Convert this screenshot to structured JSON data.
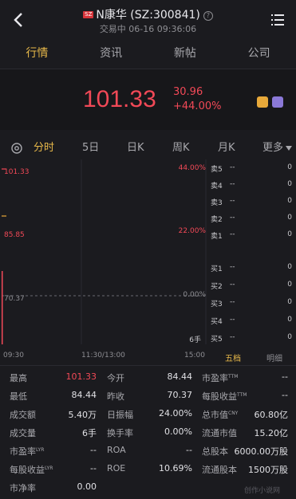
{
  "header": {
    "badge": "SZ",
    "title": "N康华 (SZ:300841)",
    "help": "?",
    "subtitle": "交易中 06-16 09:36:06"
  },
  "tabs": [
    "行情",
    "资讯",
    "新帖",
    "公司"
  ],
  "quote": {
    "price": "101.33",
    "change": "30.96",
    "change_pct": "+44.00%"
  },
  "chart_tabs": [
    "分时",
    "5日",
    "日K",
    "周K",
    "月K",
    "更多"
  ],
  "chart": {
    "y_left": [
      "101.33",
      "85.85",
      "70.37"
    ],
    "y_right": [
      "44.00%",
      "22.00%",
      "0.00%"
    ],
    "vol_label": "6手",
    "times": [
      "09:30",
      "11:30/13:00",
      "15:00"
    ]
  },
  "order_book": {
    "sell": [
      {
        "label": "卖5",
        "price": "--",
        "vol": "0"
      },
      {
        "label": "卖4",
        "price": "--",
        "vol": "0"
      },
      {
        "label": "卖3",
        "price": "--",
        "vol": "0"
      },
      {
        "label": "卖2",
        "price": "--",
        "vol": "0"
      },
      {
        "label": "卖1",
        "price": "--",
        "vol": "0"
      }
    ],
    "buy": [
      {
        "label": "买1",
        "price": "--",
        "vol": "0"
      },
      {
        "label": "买2",
        "price": "--",
        "vol": "0"
      },
      {
        "label": "买3",
        "price": "--",
        "vol": "0"
      },
      {
        "label": "买4",
        "price": "--",
        "vol": "0"
      },
      {
        "label": "买5",
        "price": "--",
        "vol": "0"
      }
    ],
    "tab_five": "五档",
    "tab_detail": "明细"
  },
  "stats": {
    "rows": [
      [
        {
          "label": "最高",
          "value": "101.33",
          "red": true
        },
        {
          "label": "今开",
          "value": "84.44",
          "red": false
        },
        {
          "label": "市盈率",
          "sup": "TTM",
          "value": "--",
          "red": false
        }
      ],
      [
        {
          "label": "最低",
          "value": "84.44",
          "red": false
        },
        {
          "label": "昨收",
          "value": "70.37",
          "red": false
        },
        {
          "label": "每股收益",
          "sup": "TTM",
          "value": "--",
          "red": false
        }
      ],
      [
        {
          "label": "成交额",
          "value": "5.40万",
          "red": false
        },
        {
          "label": "日振幅",
          "value": "24.00%",
          "red": false
        },
        {
          "label": "总市值",
          "sup": "CNY",
          "value": "60.80亿",
          "red": false
        }
      ],
      [
        {
          "label": "成交量",
          "value": "6手",
          "red": false
        },
        {
          "label": "换手率",
          "value": "0.00%",
          "red": false
        },
        {
          "label": "流通市值",
          "value": "15.20亿",
          "red": false
        }
      ],
      [
        {
          "label": "市盈率",
          "sup": "LYR",
          "value": "--",
          "red": false
        },
        {
          "label": "ROA",
          "value": "--",
          "red": false
        },
        {
          "label": "总股本",
          "value": "6000.00万股",
          "red": false
        }
      ],
      [
        {
          "label": "每股收益",
          "sup": "LYR",
          "value": "--",
          "red": false
        },
        {
          "label": "ROE",
          "value": "10.69%",
          "red": false
        },
        {
          "label": "流通股本",
          "value": "1500万股",
          "red": false
        }
      ],
      [
        {
          "label": "市净率",
          "value": "0.00",
          "red": false
        }
      ]
    ]
  },
  "watermark": "创作小说网"
}
